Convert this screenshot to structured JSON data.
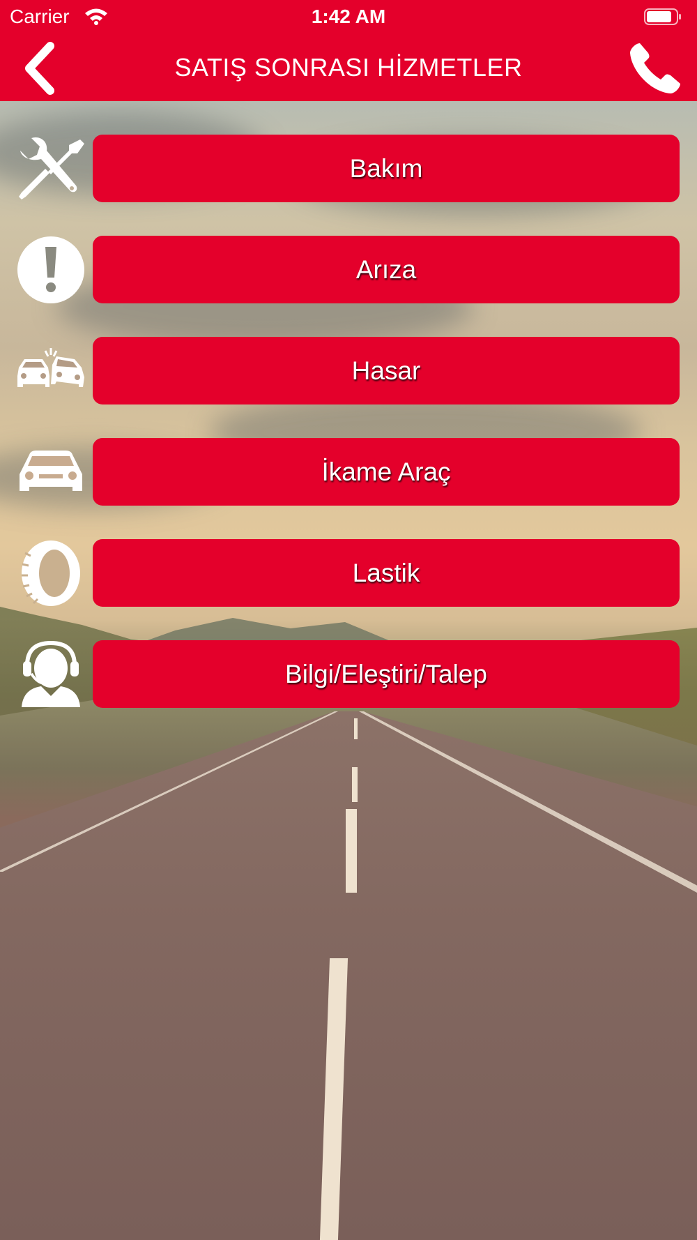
{
  "status_bar": {
    "carrier": "Carrier",
    "time": "1:42 AM"
  },
  "nav": {
    "title": "SATIŞ SONRASI HİZMETLER"
  },
  "menu": {
    "items": [
      {
        "label": "Bakım",
        "icon": "tools-icon"
      },
      {
        "label": "Arıza",
        "icon": "exclamation-icon"
      },
      {
        "label": "Hasar",
        "icon": "car-crash-icon"
      },
      {
        "label": "İkame Araç",
        "icon": "car-icon"
      },
      {
        "label": "Lastik",
        "icon": "tire-icon"
      },
      {
        "label": "Bilgi/Eleştiri/Talep",
        "icon": "support-agent-icon"
      }
    ]
  },
  "colors": {
    "accent": "#e4002b",
    "text": "#ffffff"
  }
}
